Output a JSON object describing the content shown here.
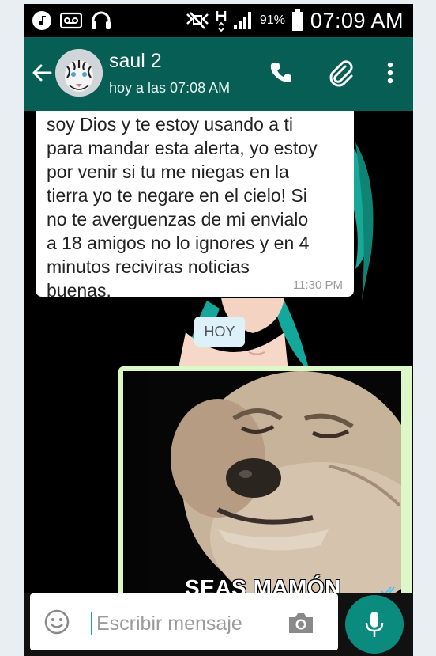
{
  "status_bar": {
    "battery_percent": "91%",
    "time": "07:09 AM"
  },
  "header": {
    "contact_name": "saul 2",
    "last_seen": "hoy a las 07:08 AM",
    "colors": {
      "toolbar": "#075e54",
      "accent": "#0a8b7e"
    },
    "icons": [
      "back-arrow-icon",
      "avatar-tiger",
      "phone-icon",
      "paperclip-icon",
      "more-vert-icon"
    ]
  },
  "chat": {
    "incoming_message": {
      "text": "soy Dios y te estoy usando a ti\npara mandar esta alerta, yo estoy\npor venir si tu me niegas en la\ntierra yo te negare en el cielo! Si\nno te averguenzas de mi envialo\na 18 amigos no lo ignores y en 4\nminutos reciviras noticias\nbuenas.",
      "time": "11:30 PM"
    },
    "date_divider": "HOY",
    "outgoing_image": {
      "caption": "SEAS MAMÓN"
    }
  },
  "composer": {
    "placeholder": "Escribir mensaje",
    "icons": [
      "emoji-icon",
      "camera-icon",
      "mic-icon"
    ]
  }
}
